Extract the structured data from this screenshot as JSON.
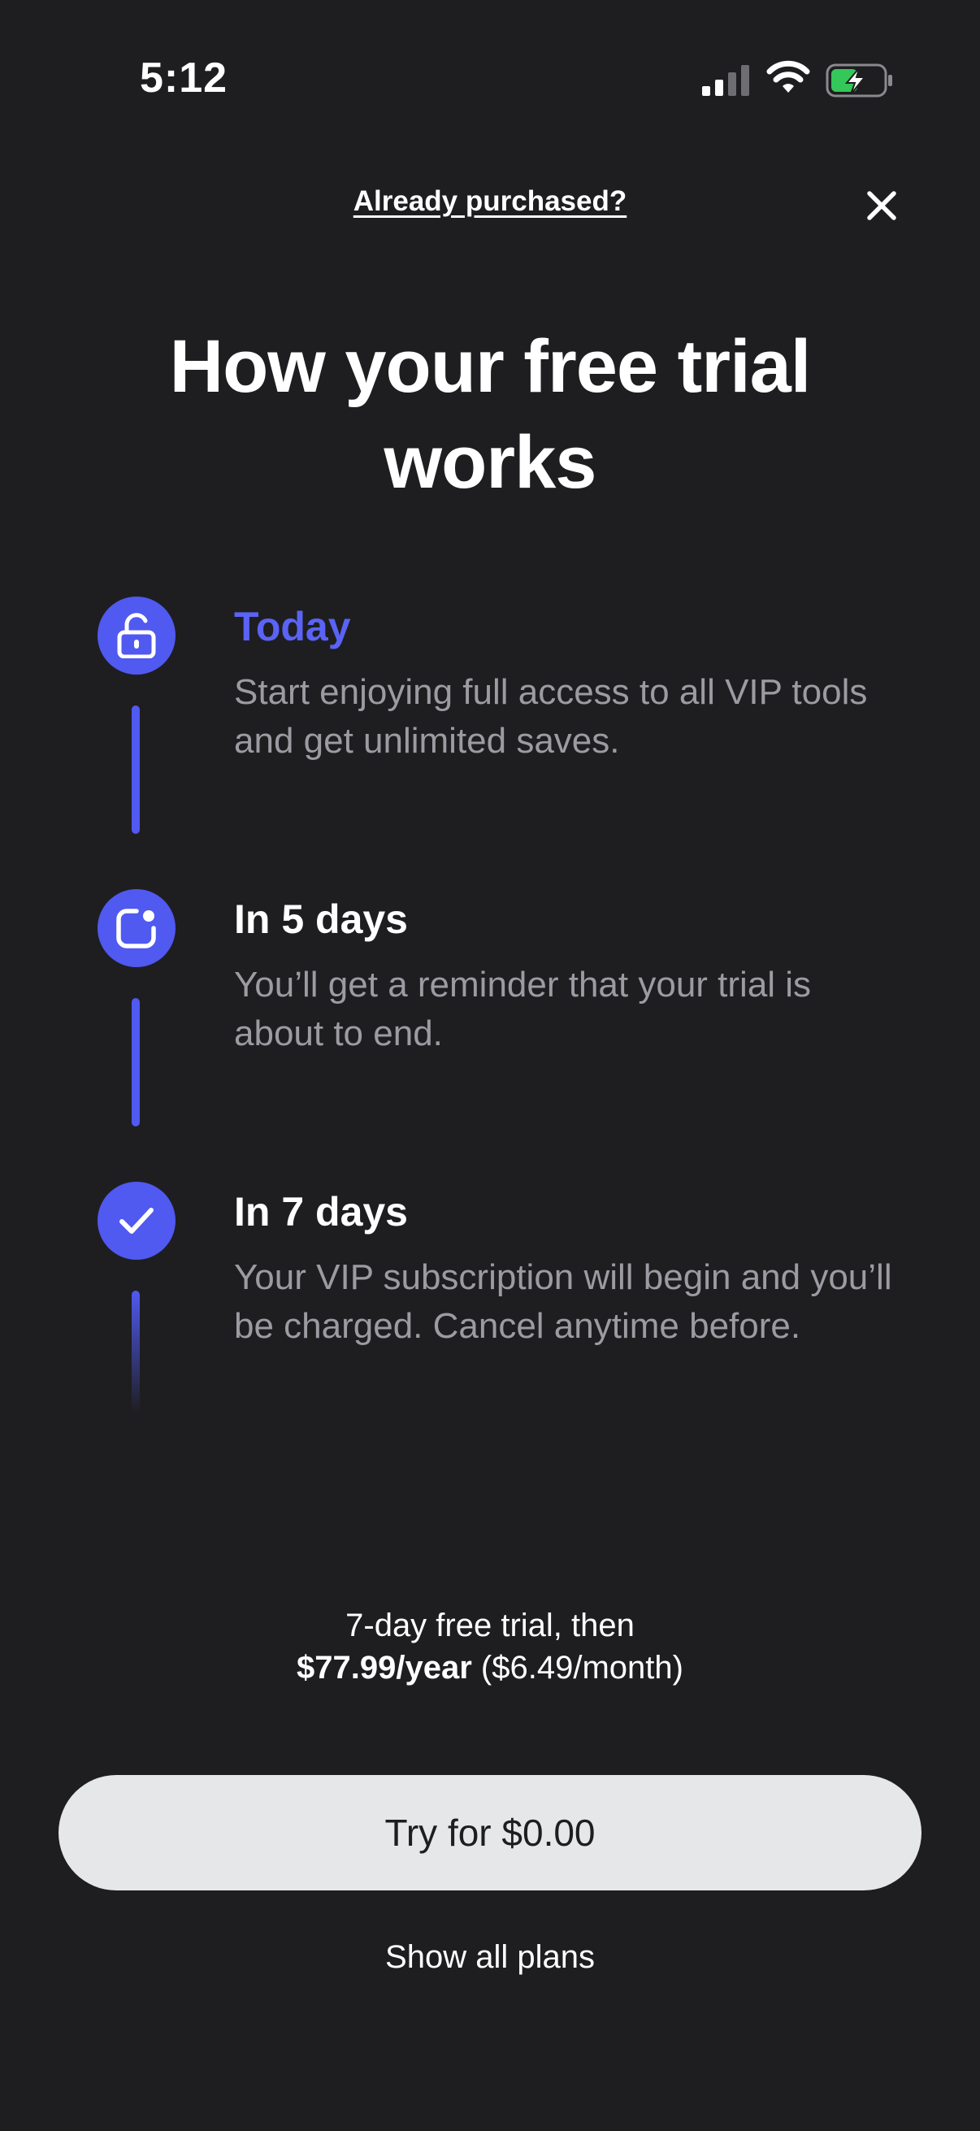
{
  "status_bar": {
    "time": "5:12",
    "icons": [
      "signal-icon",
      "wifi-icon",
      "battery-charging-icon"
    ]
  },
  "nav": {
    "already_purchased": "Already purchased?",
    "close_icon": "close-icon"
  },
  "title": "How your free trial works",
  "timeline": [
    {
      "icon": "unlock-icon",
      "title": "Today",
      "description": "Start enjoying full access to all VIP tools and get unlimited saves."
    },
    {
      "icon": "notification-icon",
      "title": "In 5 days",
      "description": "You’ll get a reminder that your trial is about to end."
    },
    {
      "icon": "check-icon",
      "title": "In 7 days",
      "description": "Your VIP subscription will begin and you’ll be charged. Cancel anytime before."
    }
  ],
  "pricing": {
    "line1": "7-day free trial, then",
    "price": "$77.99/year",
    "monthly": " ($6.49/month)"
  },
  "cta_label": "Try for $0.00",
  "show_all_plans": "Show all plans",
  "colors": {
    "background": "#1e1e20",
    "accent": "#5059f0",
    "accent_text": "#5a63f5",
    "muted_text": "#9b9ba1",
    "button_bg": "#e6e7e9"
  }
}
